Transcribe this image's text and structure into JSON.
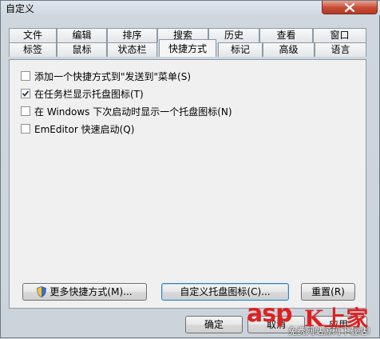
{
  "window": {
    "title": "自定义"
  },
  "tabs": {
    "row1": [
      "文件",
      "编辑",
      "排序",
      "搜索",
      "历史",
      "查看",
      "窗口"
    ],
    "row2": [
      "标签",
      "鼠标",
      "状态栏",
      "快捷方式",
      "标记",
      "高级",
      "语言"
    ],
    "active": "快捷方式"
  },
  "options": [
    {
      "label": "添加一个快捷方式到\"发送到\"菜单(S)",
      "checked": false
    },
    {
      "label": "在任务栏显示托盘图标(T)",
      "checked": true
    },
    {
      "label": "在 Windows 下次启动时显示一个托盘图标(N)",
      "checked": false
    },
    {
      "label": "EmEditor 快速启动(Q)",
      "checked": false
    }
  ],
  "buttons": {
    "more_shortcuts": "更多快捷方式(M)...",
    "customize_tray": "自定义托盘图标(C)...",
    "reset": "重置(R)",
    "ok": "确定",
    "cancel": "取消",
    "apply": "应用"
  },
  "watermark": {
    "brand": "asp",
    "mark": "K上家",
    "subtitle": "免费网站源码下载站!"
  },
  "colors": {
    "close_button": "#c74a33",
    "watermark": "#e02020"
  }
}
